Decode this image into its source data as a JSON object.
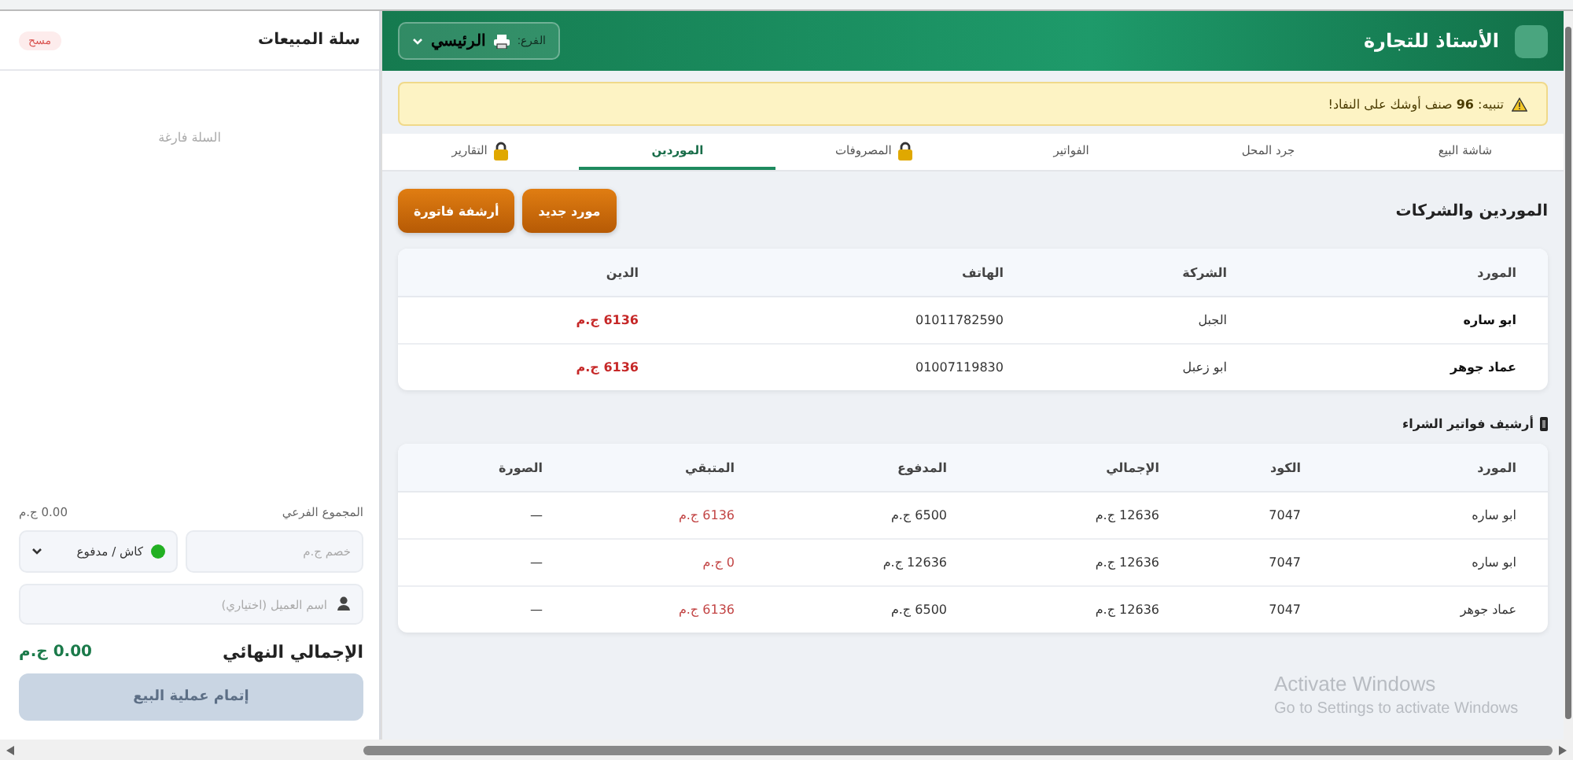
{
  "header": {
    "title": "الأستاذ للتجارة",
    "branch_label": "الفرع:",
    "branch": "الرئيسي"
  },
  "alert": {
    "text": "تنبيه: **96** صنف أوشك على النفاد!"
  },
  "tabs": [
    {
      "label": "شاشة البيع",
      "locked": false,
      "selected": false
    },
    {
      "label": "جرد المحل",
      "locked": false,
      "selected": false
    },
    {
      "label": "الفواتير",
      "locked": false,
      "selected": false
    },
    {
      "label": "المصروفات",
      "locked": true,
      "selected": false
    },
    {
      "label": "الموردين",
      "locked": false,
      "selected": true
    },
    {
      "label": "التقارير",
      "locked": true,
      "selected": false
    }
  ],
  "suppliers": {
    "title": "الموردين والشركات",
    "buttons": [
      "مورد جديد",
      "أرشفة فاتورة"
    ],
    "table": {
      "columns": [
        {
          "label": "المورد",
          "kind": "strong"
        },
        {
          "label": "الشركة",
          "kind": "plain"
        },
        {
          "label": "الهاتف",
          "kind": "plain"
        },
        {
          "label": "الدين",
          "kind": "debt_strong"
        }
      ],
      "rows": [
        [
          "ابو ساره",
          "الجبل",
          "01011782590",
          "6136 ج.م"
        ],
        [
          "عماد جوهر",
          "ابو زعبل",
          "01007119830",
          "6136 ج.م"
        ]
      ]
    }
  },
  "archive": {
    "title": "أرشيف فواتير الشراء",
    "table": {
      "columns": [
        {
          "label": "المورد",
          "kind": "plain"
        },
        {
          "label": "الكود",
          "kind": "plain"
        },
        {
          "label": "الإجمالي",
          "kind": "plain"
        },
        {
          "label": "المدفوع",
          "kind": "plain"
        },
        {
          "label": "المتبقي",
          "kind": "debt"
        },
        {
          "label": "الصورة",
          "kind": "plain"
        }
      ],
      "rows": [
        [
          "ابو ساره",
          "7047",
          "12636 ج.م",
          "6500 ج.م",
          "6136 ج.م",
          "—"
        ],
        [
          "ابو ساره",
          "7047",
          "12636 ج.م",
          "12636 ج.م",
          "0 ج.م",
          "—"
        ],
        [
          "عماد جوهر",
          "7047",
          "12636 ج.م",
          "6500 ج.م",
          "6136 ج.م",
          "—"
        ]
      ]
    }
  },
  "cart": {
    "title": "سلة المبيعات",
    "clear": "مسح",
    "empty": "السلة فارغة",
    "subtotal_label": "المجموع الفرعي",
    "subtotal": "0.00 ج.م",
    "discount_placeholder": "خصم ج.م",
    "payment": "كاش / مدفوع",
    "customer_placeholder": "اسم العميل (اختياري)",
    "total_label": "الإجمالي النهائي",
    "total": "0.00 ج.م",
    "submit": {
      "label": "إتمام عملية البيع",
      "disabled": true
    }
  },
  "os_notice": {
    "title": "Activate Windows",
    "text": "Go to Settings to activate Windows"
  }
}
